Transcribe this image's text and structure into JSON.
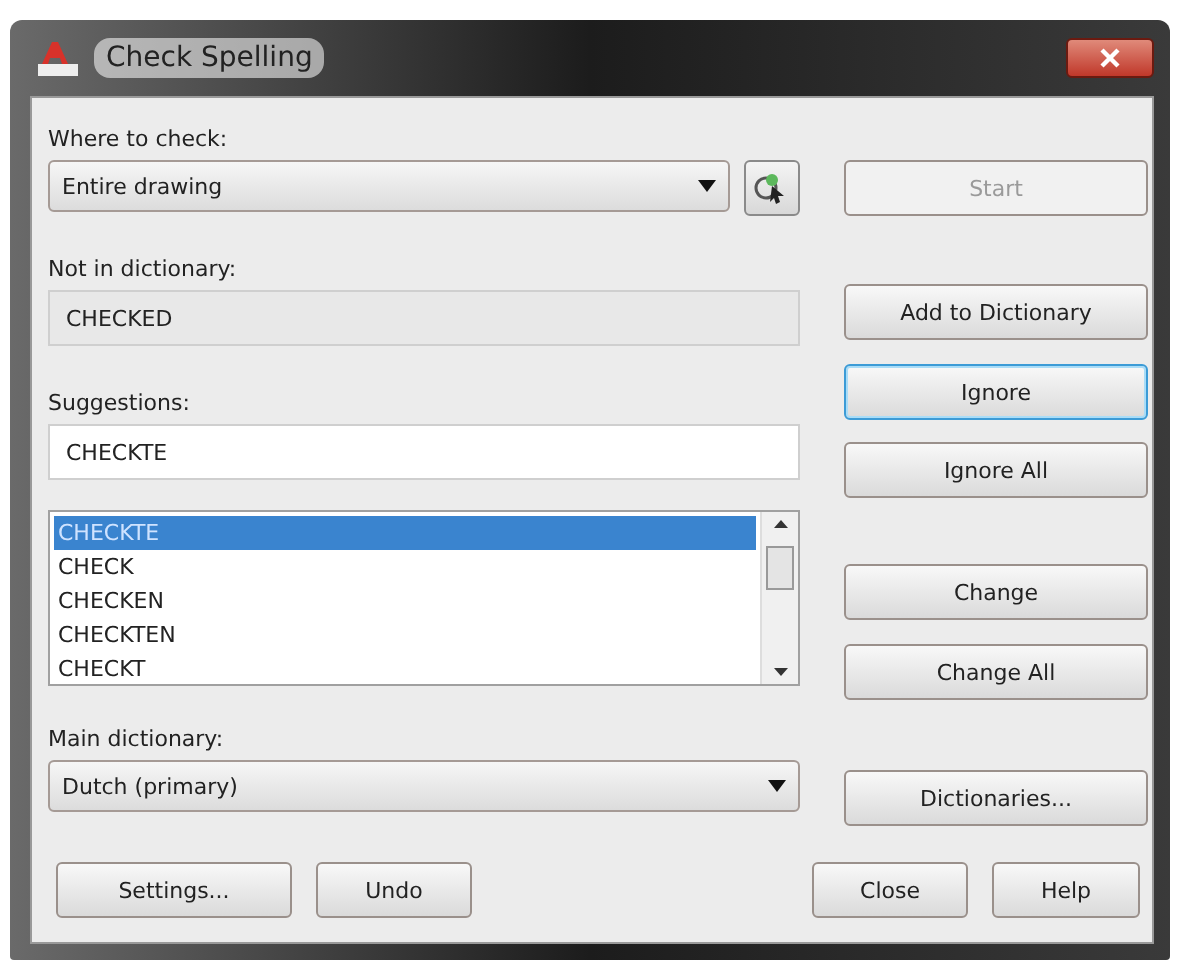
{
  "window": {
    "title": "Check Spelling"
  },
  "where_to_check": {
    "label": "Where to check:",
    "value": "Entire drawing"
  },
  "start_button": {
    "label": "Start",
    "disabled": true
  },
  "not_in_dictionary": {
    "label": "Not in dictionary:",
    "value": "CHECKED"
  },
  "add_button": {
    "label": "Add to Dictionary",
    "focused": false
  },
  "ignore_button": {
    "label": "Ignore",
    "focused": true
  },
  "ignore_all_button": {
    "label": "Ignore All",
    "focused": false
  },
  "suggestions": {
    "label": "Suggestions:",
    "value": "CHECKTE",
    "list": [
      {
        "text": "CHECKTE",
        "selected": true
      },
      {
        "text": "CHECK",
        "selected": false
      },
      {
        "text": "CHECKEN",
        "selected": false
      },
      {
        "text": "CHECKTEN",
        "selected": false
      },
      {
        "text": "CHECKT",
        "selected": false
      }
    ]
  },
  "change_button": {
    "label": "Change",
    "focused": false
  },
  "change_all_button": {
    "label": "Change All",
    "focused": false
  },
  "main_dictionary": {
    "label": "Main dictionary:",
    "value": "Dutch (primary)"
  },
  "dictionaries_button": {
    "label": "Dictionaries...",
    "focused": false
  },
  "bottom_buttons": [
    {
      "label": "Settings...",
      "focused": false
    },
    {
      "label": "Undo",
      "focused": false
    },
    {
      "label": "Close",
      "focused": false
    },
    {
      "label": "Help",
      "focused": false
    }
  ]
}
